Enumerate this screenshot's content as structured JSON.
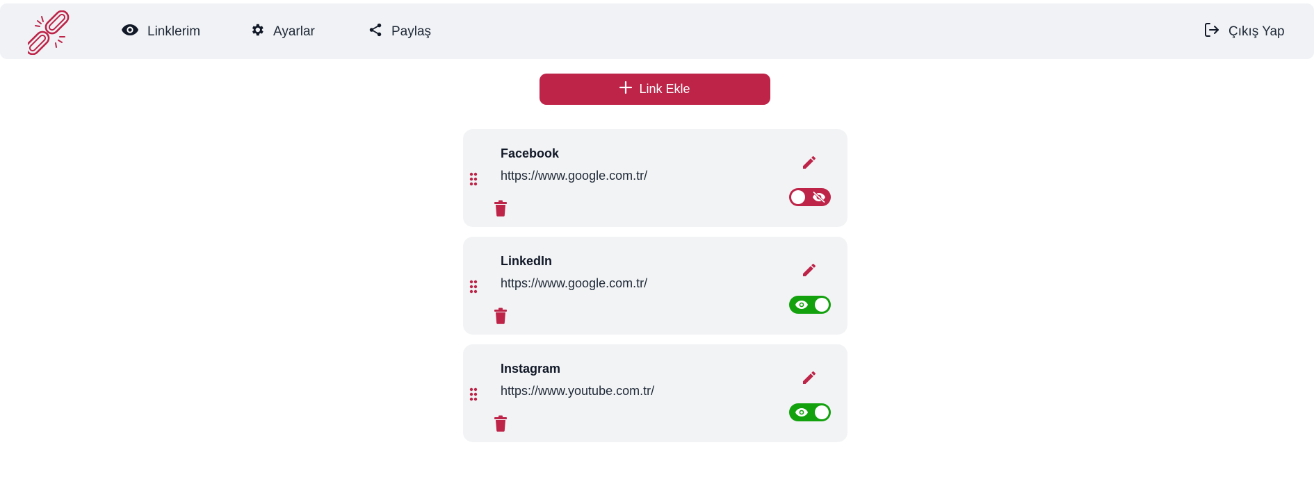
{
  "nav": {
    "logo_icon": "broken-chain-logo",
    "items": [
      {
        "label": "Linklerim",
        "icon": "eye-icon"
      },
      {
        "label": "Ayarlar",
        "icon": "gear-icon"
      },
      {
        "label": "Paylaş",
        "icon": "share-icon"
      }
    ],
    "logout": {
      "label": "Çıkış Yap",
      "icon": "logout-icon"
    }
  },
  "add_button": {
    "label": "Link Ekle",
    "icon": "plus-icon"
  },
  "links": [
    {
      "title": "Facebook",
      "url": "https://www.google.com.tr/",
      "visible": false
    },
    {
      "title": "LinkedIn",
      "url": "https://www.google.com.tr/",
      "visible": true
    },
    {
      "title": "Instagram",
      "url": "https://www.youtube.com.tr/",
      "visible": true
    }
  ],
  "colors": {
    "accent": "#be2348",
    "toggle_on": "#13a10e",
    "nav_bg": "#f0f2f5",
    "card_bg": "#f2f3f5"
  }
}
